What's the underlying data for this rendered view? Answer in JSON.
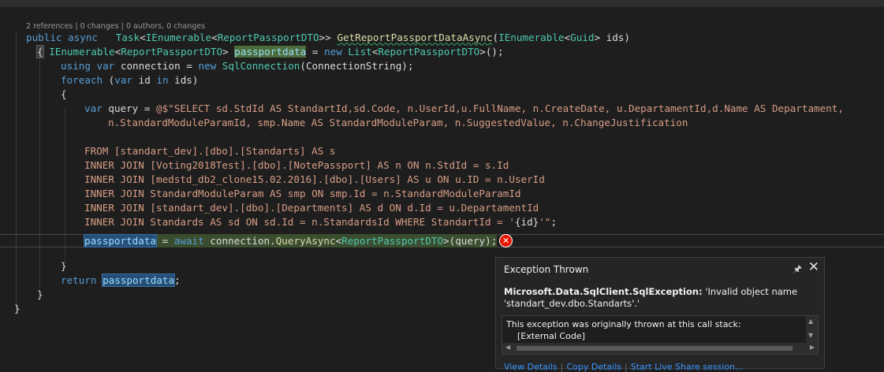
{
  "codelens": "2 references | 0 changes | 0 authors, 0 changes",
  "code": {
    "sig_public": "public",
    "sig_async": "async",
    "sig_task": "Task",
    "sig_lt": "<",
    "sig_ienum": "IEnumerable",
    "sig_dto": "ReportPassportDTO",
    "sig_gtgt": ">>",
    "sig_method": "GetReportPassportDataAsync",
    "sig_paren": "(",
    "sig_ienum2": "IEnumerable",
    "sig_guid": "Guid",
    "sig_tail": "> ids)",
    "l2_brace": "{",
    "l2_ienum": "IEnumerable",
    "l2_lt": "<",
    "l2_dto": "ReportPassportDTO",
    "l2_gt": ">",
    "l2_var": "passportdata",
    "l2_eq": "=",
    "l2_new": "new",
    "l2_list": "List",
    "l2_dto2": "ReportPassportDTO",
    "l2_tail": ">();",
    "l3_using": "using",
    "l3_var": "var",
    "l3_name": "connection =",
    "l3_new": "new",
    "l3_type": "SqlConnection",
    "l3_tail": "(ConnectionString);",
    "l4_foreach": "foreach",
    "l4_open": "(",
    "l4_var": "var",
    "l4_id": "id",
    "l4_in": "in",
    "l4_tail": "ids)",
    "l5_brace": "{",
    "l6_var": "var",
    "l6_mid": "query =",
    "l6_str": "@$\"SELECT sd.StdId AS StandartId,sd.Code, n.UserId,u.FullName, n.CreateDate, u.DepartamentId,d.Name AS Departament,",
    "l7_str": "n.StandardModuleParamId, smp.Name AS StandardModuleParam, n.SuggestedValue, n.ChangeJustification",
    "l9_str": "FROM [standart_dev].[dbo].[Standarts] AS s",
    "l10_str": "INNER JOIN [Voting2018Test].[dbo].[NotePassport] AS n ON n.StdId = s.Id",
    "l11_str": "INNER JOIN [medstd_db2_clone15.02.2016].[dbo].[Users] AS u ON u.ID = n.UserId",
    "l12_str": "INNER JOIN StandardModuleParam AS smp ON smp.Id = n.StandardModuleParamId",
    "l13_str": "INNER JOIN [standart_dev].[dbo].[Departments] AS d ON d.Id = u.DepartamentId",
    "l14_str1": "INNER JOIN Standards AS sd ON sd.Id = n.StandardsId WHERE StandartId = '",
    "l14_interp": "{id}",
    "l14_str2": "'\"",
    "l14_tail": ";",
    "l15_var": "passportdata",
    "l15_eq": "=",
    "l15_await": "await",
    "l15_conn": "connection.",
    "l15_method": "QueryAsync",
    "l15_lt": "<",
    "l15_dto": "ReportPassportDTO",
    "l15_tail": ">(query);",
    "l17_brace": "}",
    "l18_return": "return",
    "l18_var": "passportdata",
    "l18_semi": ";",
    "l19_brace": "}",
    "l20_brace": "}"
  },
  "exception": {
    "title": "Exception Thrown",
    "pin_icon": "pin-icon",
    "close_icon": "close-icon",
    "type": "Microsoft.Data.SqlClient.SqlException:",
    "message": "'Invalid object name 'standart_dev.dbo.Standarts'.'",
    "stack_header": "This exception was originally thrown at this call stack:",
    "stack_item": "[External Code]",
    "links": [
      "View Details",
      "Copy Details",
      "Start Live Share session..."
    ]
  },
  "colors": {
    "background": "#1e1e1e",
    "keyword": "#569cd6",
    "type": "#4ec9b0",
    "string": "#d69d85",
    "error": "#e51400",
    "link": "#3794ff"
  }
}
